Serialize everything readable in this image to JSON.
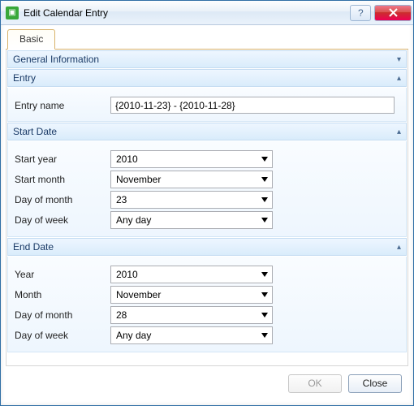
{
  "window": {
    "title": "Edit Calendar Entry",
    "help_icon": "help-icon",
    "close_icon": "close-icon"
  },
  "tabs": {
    "basic": "Basic"
  },
  "sections": {
    "general": {
      "title": "General Information"
    },
    "entry": {
      "title": "Entry",
      "fields": {
        "entry_name": {
          "label": "Entry name",
          "value": "{2010-11-23} - {2010-11-28}"
        }
      }
    },
    "start": {
      "title": "Start Date",
      "fields": {
        "year": {
          "label": "Start year",
          "value": "2010"
        },
        "month": {
          "label": "Start month",
          "value": "November"
        },
        "dom": {
          "label": "Day of month",
          "value": "23"
        },
        "dow": {
          "label": "Day of week",
          "value": "Any day"
        }
      }
    },
    "end": {
      "title": "End Date",
      "fields": {
        "year": {
          "label": "Year",
          "value": "2010"
        },
        "month": {
          "label": "Month",
          "value": "November"
        },
        "dom": {
          "label": "Day of month",
          "value": "28"
        },
        "dow": {
          "label": "Day of week",
          "value": "Any day"
        }
      }
    }
  },
  "footer": {
    "ok": "OK",
    "close": "Close"
  }
}
